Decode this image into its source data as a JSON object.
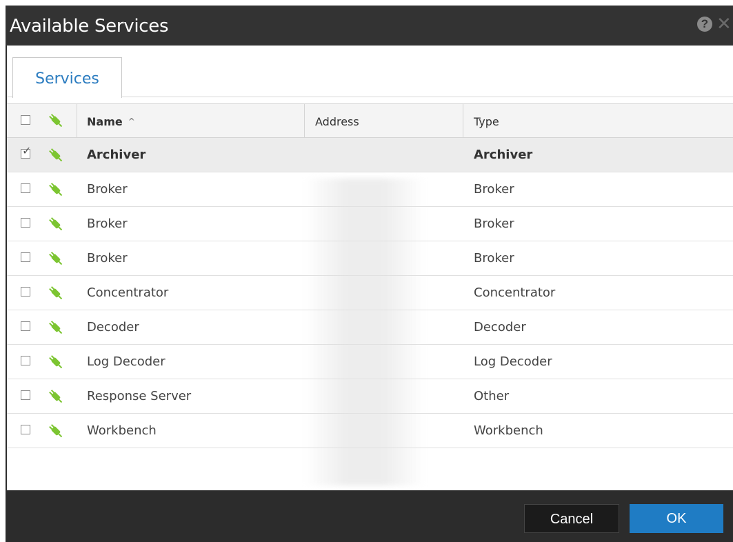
{
  "dialog": {
    "title": "Available Services",
    "help_icon": "question-circle-icon",
    "close_icon": "close-icon"
  },
  "tabs": [
    {
      "label": "Services",
      "active": true
    }
  ],
  "table": {
    "columns": {
      "name": "Name",
      "address": "Address",
      "type": "Type"
    },
    "sort": {
      "column": "Name",
      "direction": "ascending"
    },
    "rows": [
      {
        "checked": true,
        "name": "Archiver",
        "address": "",
        "type": "Archiver"
      },
      {
        "checked": false,
        "name": "Broker",
        "address": "",
        "type": "Broker"
      },
      {
        "checked": false,
        "name": "Broker",
        "address": "",
        "type": "Broker"
      },
      {
        "checked": false,
        "name": "Broker",
        "address": "",
        "type": "Broker"
      },
      {
        "checked": false,
        "name": "Concentrator",
        "address": "",
        "type": "Concentrator"
      },
      {
        "checked": false,
        "name": "Decoder",
        "address": "",
        "type": "Decoder"
      },
      {
        "checked": false,
        "name": "Log Decoder",
        "address": "",
        "type": "Log Decoder"
      },
      {
        "checked": false,
        "name": "Response Server",
        "address": "",
        "type": "Other"
      },
      {
        "checked": false,
        "name": "Workbench",
        "address": "",
        "type": "Workbench"
      }
    ]
  },
  "footer": {
    "cancel_label": "Cancel",
    "ok_label": "OK"
  },
  "colors": {
    "accent": "#2b7cc0",
    "ok_button": "#1f7cc4",
    "plug_icon": "#7cc531",
    "titlebar": "#333333"
  }
}
